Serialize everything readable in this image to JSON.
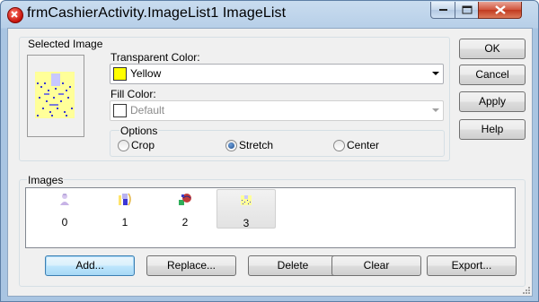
{
  "window": {
    "title": "frmCashierActivity.ImageList1 ImageList"
  },
  "selected_image": {
    "label": "Selected Image"
  },
  "transparent_color": {
    "label": "Transparent Color:",
    "value": "Yellow",
    "swatch": "#ffff00"
  },
  "fill_color": {
    "label": "Fill Color:",
    "value": "Default",
    "swatch": "#ffffff"
  },
  "options": {
    "label": "Options",
    "items": [
      {
        "label": "Crop",
        "checked": false
      },
      {
        "label": "Stretch",
        "checked": true
      },
      {
        "label": "Center",
        "checked": false
      }
    ]
  },
  "side_buttons": {
    "ok": "OK",
    "cancel": "Cancel",
    "apply": "Apply",
    "help": "Help"
  },
  "images": {
    "label": "Images",
    "items": [
      {
        "caption": "0",
        "icon": "person-icon"
      },
      {
        "caption": "1",
        "icon": "cashier-icon"
      },
      {
        "caption": "2",
        "icon": "globe-icon"
      },
      {
        "caption": "3",
        "icon": "pattern-icon",
        "selected": true
      }
    ]
  },
  "bottom_buttons": {
    "add": "Add...",
    "replace": "Replace...",
    "delete": "Delete",
    "clear": "Clear",
    "export": "Export..."
  }
}
